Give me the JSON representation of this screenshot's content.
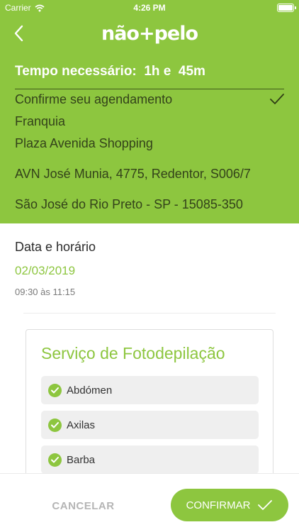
{
  "status_bar": {
    "carrier": "Carrier",
    "time": "4:26 PM"
  },
  "header": {
    "logo": "não+pelo",
    "tempo": "Tempo necessário:  1h e  45m",
    "confirm_title": "Confirme seu agendamento",
    "type": "Franquia",
    "location_name": "Plaza Avenida Shopping",
    "address": "AVN José Munia, 4775, Redentor, S006/7",
    "city": "São José do Rio Preto - SP - 15085-350"
  },
  "schedule": {
    "title": "Data e horário",
    "date": "02/03/2019",
    "time": "09:30 às 11:15"
  },
  "services": {
    "title": "Serviço de Fotodepilação",
    "items": [
      {
        "label": "Abdómen"
      },
      {
        "label": "Axilas"
      },
      {
        "label": "Barba"
      }
    ]
  },
  "footer": {
    "cancel_label": "CANCELAR",
    "confirm_label": "CONFIRMAR"
  },
  "colors": {
    "accent": "#8dc63f",
    "header_text": "#33421a",
    "muted": "#b5b5b5"
  },
  "icons": [
    "wifi-icon",
    "battery-icon",
    "back-arrow-icon",
    "checkmark-icon",
    "check-circle-icon"
  ]
}
